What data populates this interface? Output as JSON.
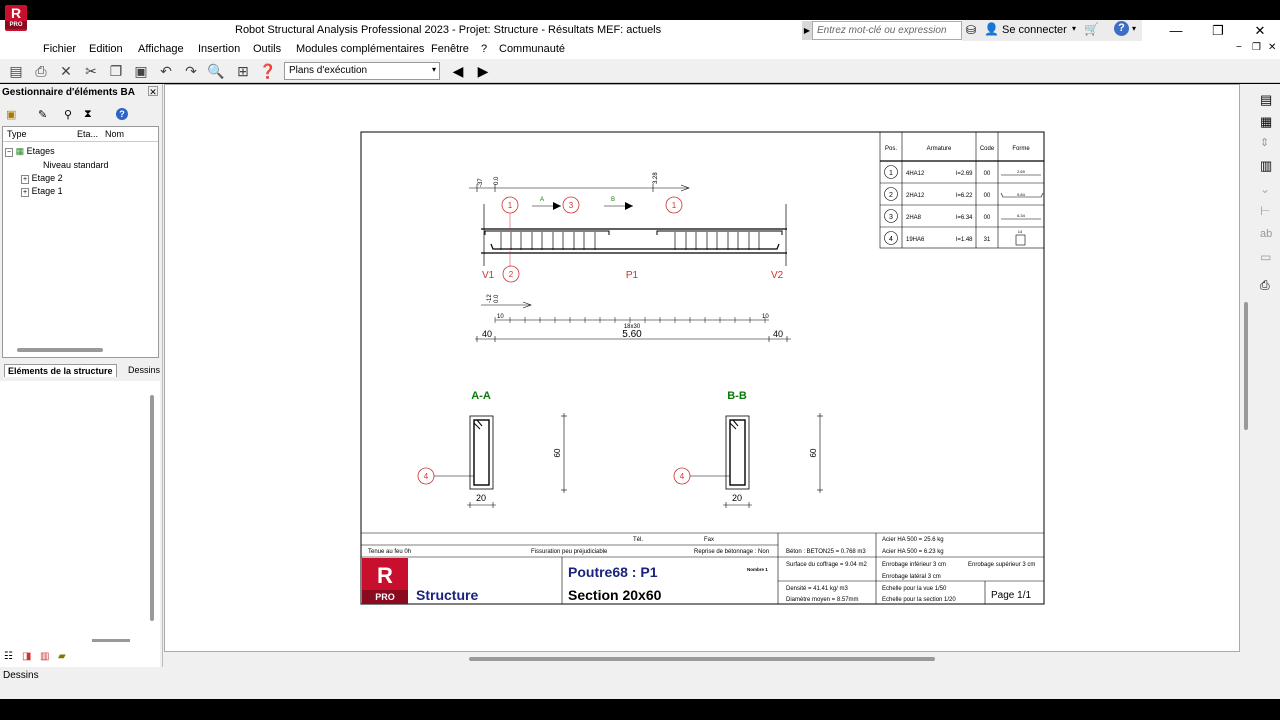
{
  "window": {
    "title": "Robot Structural Analysis Professional 2023 - Projet: Structure - Résultats MEF: actuels",
    "search_placeholder": "Entrez mot-clé ou expression",
    "signin_label": "Se connecter",
    "app_icon_letter": "R",
    "app_icon_badge": "PRO"
  },
  "menu": [
    "Fichier",
    "Edition",
    "Affichage",
    "Insertion",
    "Outils",
    "Modules complémentaires",
    "Fenêtre",
    "?",
    "Communauté"
  ],
  "toolbar": {
    "view_select_value": "Plans d'exécution"
  },
  "left_panel": {
    "title": "Gestionnaire d'éléments BA",
    "columns": [
      "Type",
      "Eta...",
      "Nom"
    ],
    "tree": {
      "root": "Etages",
      "children": [
        "Niveau standard",
        "Etage 2",
        "Etage 1"
      ]
    },
    "tabs": [
      "Eléments de la structure",
      "Dessins"
    ]
  },
  "status": {
    "text": "Dessins"
  },
  "drawing": {
    "elevation": {
      "dims_top": [
        "-37",
        "0.0",
        "3.28"
      ],
      "markers_top": [
        "1",
        "3",
        "1"
      ],
      "section_marks": [
        "A",
        "B"
      ],
      "support_left": "V1",
      "support_right": "V2",
      "beam_label": "P1",
      "marker_bottom": "2",
      "dims_mid": [
        "-12",
        "0.0"
      ],
      "stirrup_count": "18x30",
      "dim_small_left": "10",
      "dim_small_right": "10",
      "dim_left": "40",
      "span": "5.60",
      "dim_right": "40"
    },
    "sections": [
      {
        "title": "A-A",
        "marker": "4",
        "height": "60",
        "width": "20"
      },
      {
        "title": "B-B",
        "marker": "4",
        "height": "60",
        "width": "20"
      }
    ],
    "bar_table": {
      "headers": [
        "Pos.",
        "Armature",
        "Code",
        "Forme"
      ],
      "rows": [
        {
          "pos": "1",
          "bar": "4HA12",
          "length": "l=2.69",
          "code": "00",
          "shape": "2.69"
        },
        {
          "pos": "2",
          "bar": "2HA12",
          "length": "l=6.22",
          "code": "00",
          "shape": "5.84"
        },
        {
          "pos": "3",
          "bar": "2HA8",
          "length": "l=6.34",
          "code": "00",
          "shape": "6.34"
        },
        {
          "pos": "4",
          "bar": "19HA6",
          "length": "l=1.48",
          "code": "31",
          "shape": "14"
        }
      ]
    },
    "title_block": {
      "tel": "Tél.",
      "fax": "Fax",
      "fire": "Tenue au feu 0h",
      "cracking": "Fissuration peu préjudiciable",
      "pouring": "Reprise de bétonnage : Non",
      "logo_letter": "R",
      "logo_badge": "PRO",
      "project": "Structure",
      "element": "Poutre68 : P1",
      "number": "Nombre 1",
      "section": "Section 20x60",
      "concrete": "Béton : BETON25 = 0.768 m3",
      "formwork": "Surface du coffrage = 9.04 m2",
      "density": "Densité = 41.41 kg/ m3",
      "diameter": "Diamètre moyen = 8.57mm",
      "steel1": "Acier HA 500 = 25.6 kg",
      "steel2": "Acier HA 500 = 6.23 kg",
      "cover_bottom": "Enrobage inférieur 3 cm",
      "cover_top": "Enrobage supérieur 3 cm",
      "cover_side": "Enrobage latéral 3 cm",
      "scale_view": "Echelle pour la vue 1/50",
      "scale_section": "Echelle pour la section 1/20",
      "page": "Page 1/1"
    }
  }
}
